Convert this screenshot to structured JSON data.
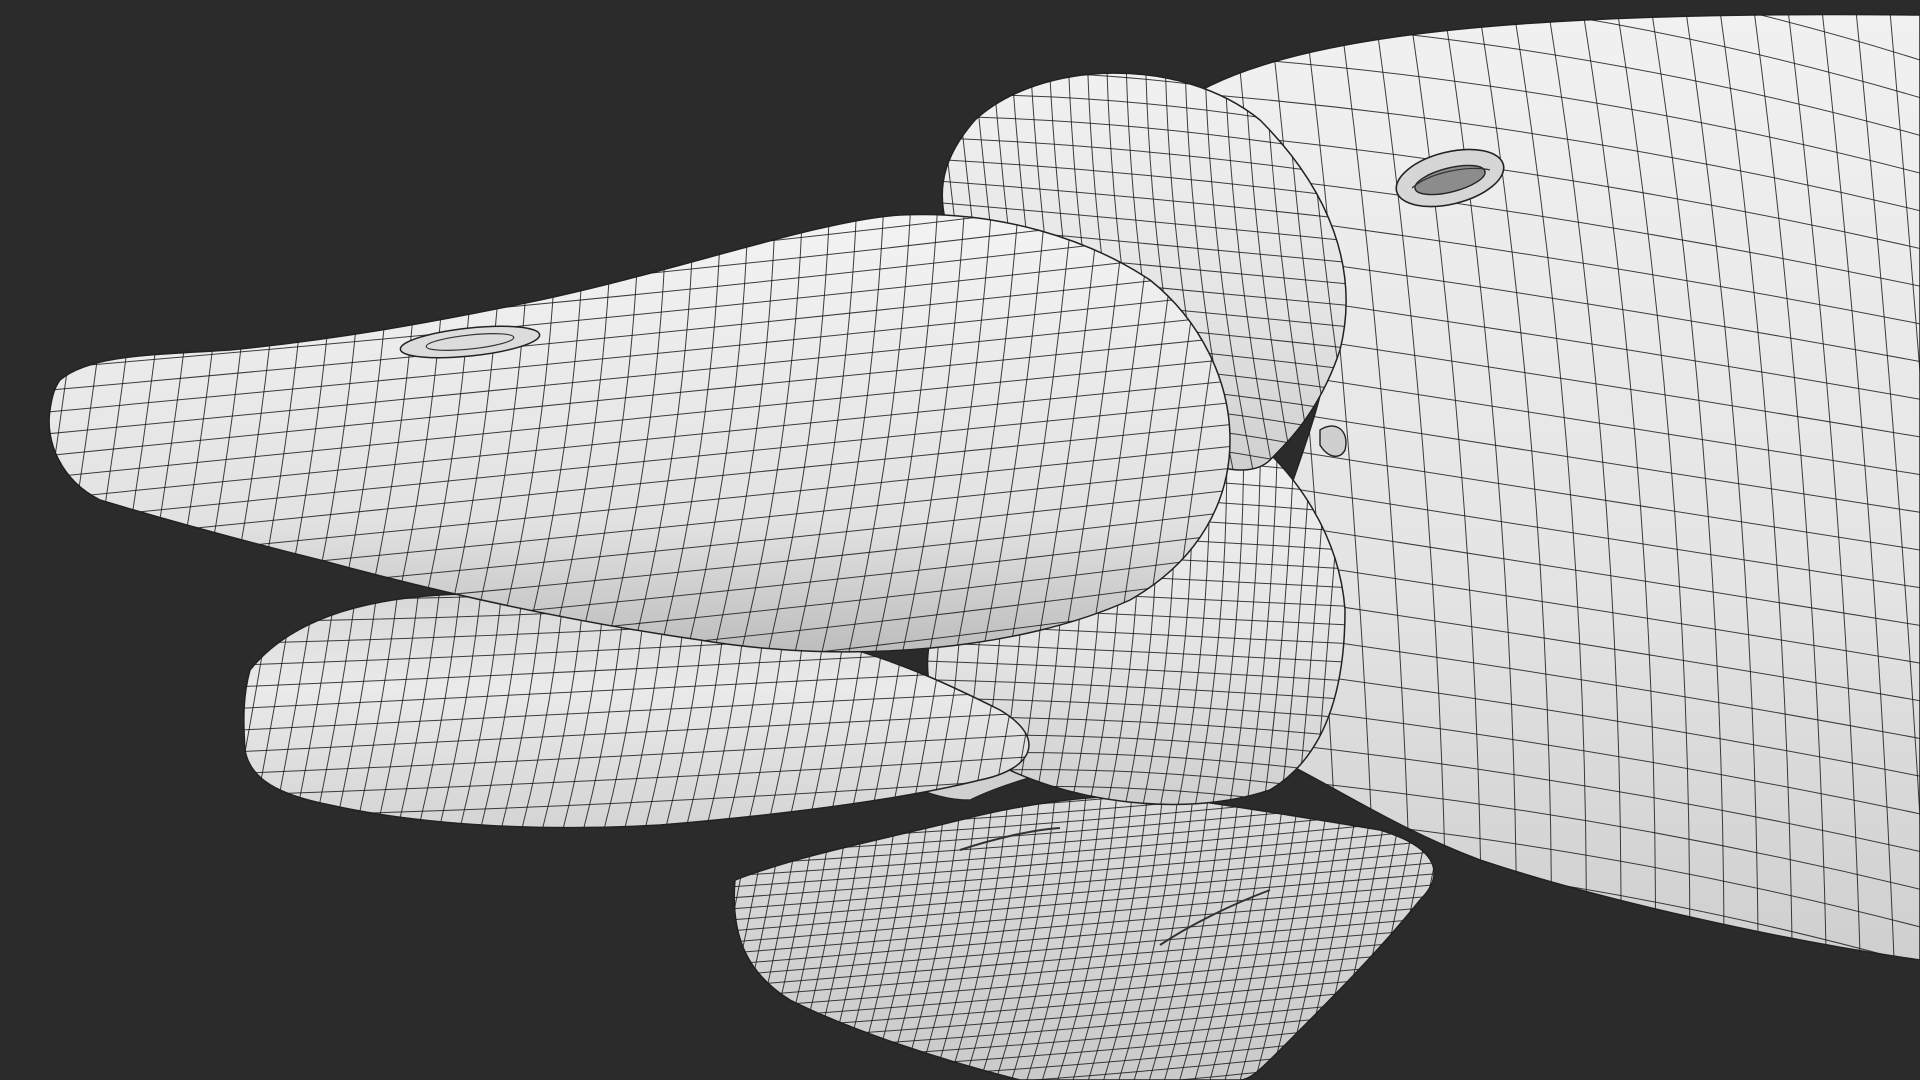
{
  "scene": {
    "subject": "platypus-head-wireframe",
    "colors": {
      "background": "#2b2b2b",
      "surface": "#e9e9e9",
      "surface_shade": "#c9c9c9",
      "surface_dark": "#b2b2b2",
      "wire": "#1c1c1c"
    }
  }
}
